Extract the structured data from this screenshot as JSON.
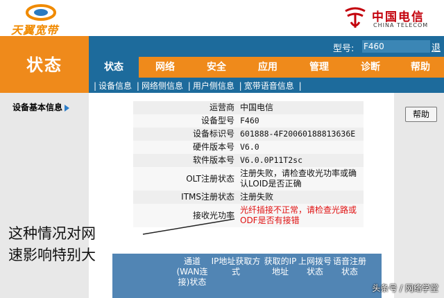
{
  "header": {
    "brand_left": "天翼宽带",
    "brand_right_cn": "中国电信",
    "brand_right_en": "CHINA TELECOM"
  },
  "page_title": "状态",
  "model": {
    "label": "型号:",
    "value": "F460",
    "logout": "退"
  },
  "tabs": [
    "状态",
    "网络",
    "安全",
    "应用",
    "管理",
    "诊断",
    "帮助"
  ],
  "subnav": [
    "设备信息",
    "网络侧信息",
    "用户侧信息",
    "宽带语音信息"
  ],
  "sidebar": {
    "item": "设备基本信息"
  },
  "help_button": "帮助",
  "device_info": [
    {
      "key": "运营商",
      "value": "中国电信"
    },
    {
      "key": "设备型号",
      "value": "F460"
    },
    {
      "key": "设备标识号",
      "value": "601888-4F20060188813636E"
    },
    {
      "key": "硬件版本号",
      "value": "V6.0"
    },
    {
      "key": "软件版本号",
      "value": "V6.0.0P11T2sc"
    },
    {
      "key": "OLT注册状态",
      "value": "注册失败，请检查收光功率或确认LOID是否正确"
    },
    {
      "key": "ITMS注册状态",
      "value": "注册失败"
    },
    {
      "key": "接收光功率",
      "value": "光纤插接不正常，请检查光路或ODF是否有接错"
    }
  ],
  "wan_headers": [
    "通道(WAN连接)状态",
    "IP地址获取方式",
    "获取的IP地址",
    "上网拨号状态",
    "语音注册状态"
  ],
  "annotation": [
    "这种情况对网",
    "速影响特别大"
  ],
  "watermark": "头条号 / 网络学堂",
  "colors": {
    "orange": "#ef8a1b",
    "blue": "#1d6b9c",
    "red_text": "#e01010"
  }
}
